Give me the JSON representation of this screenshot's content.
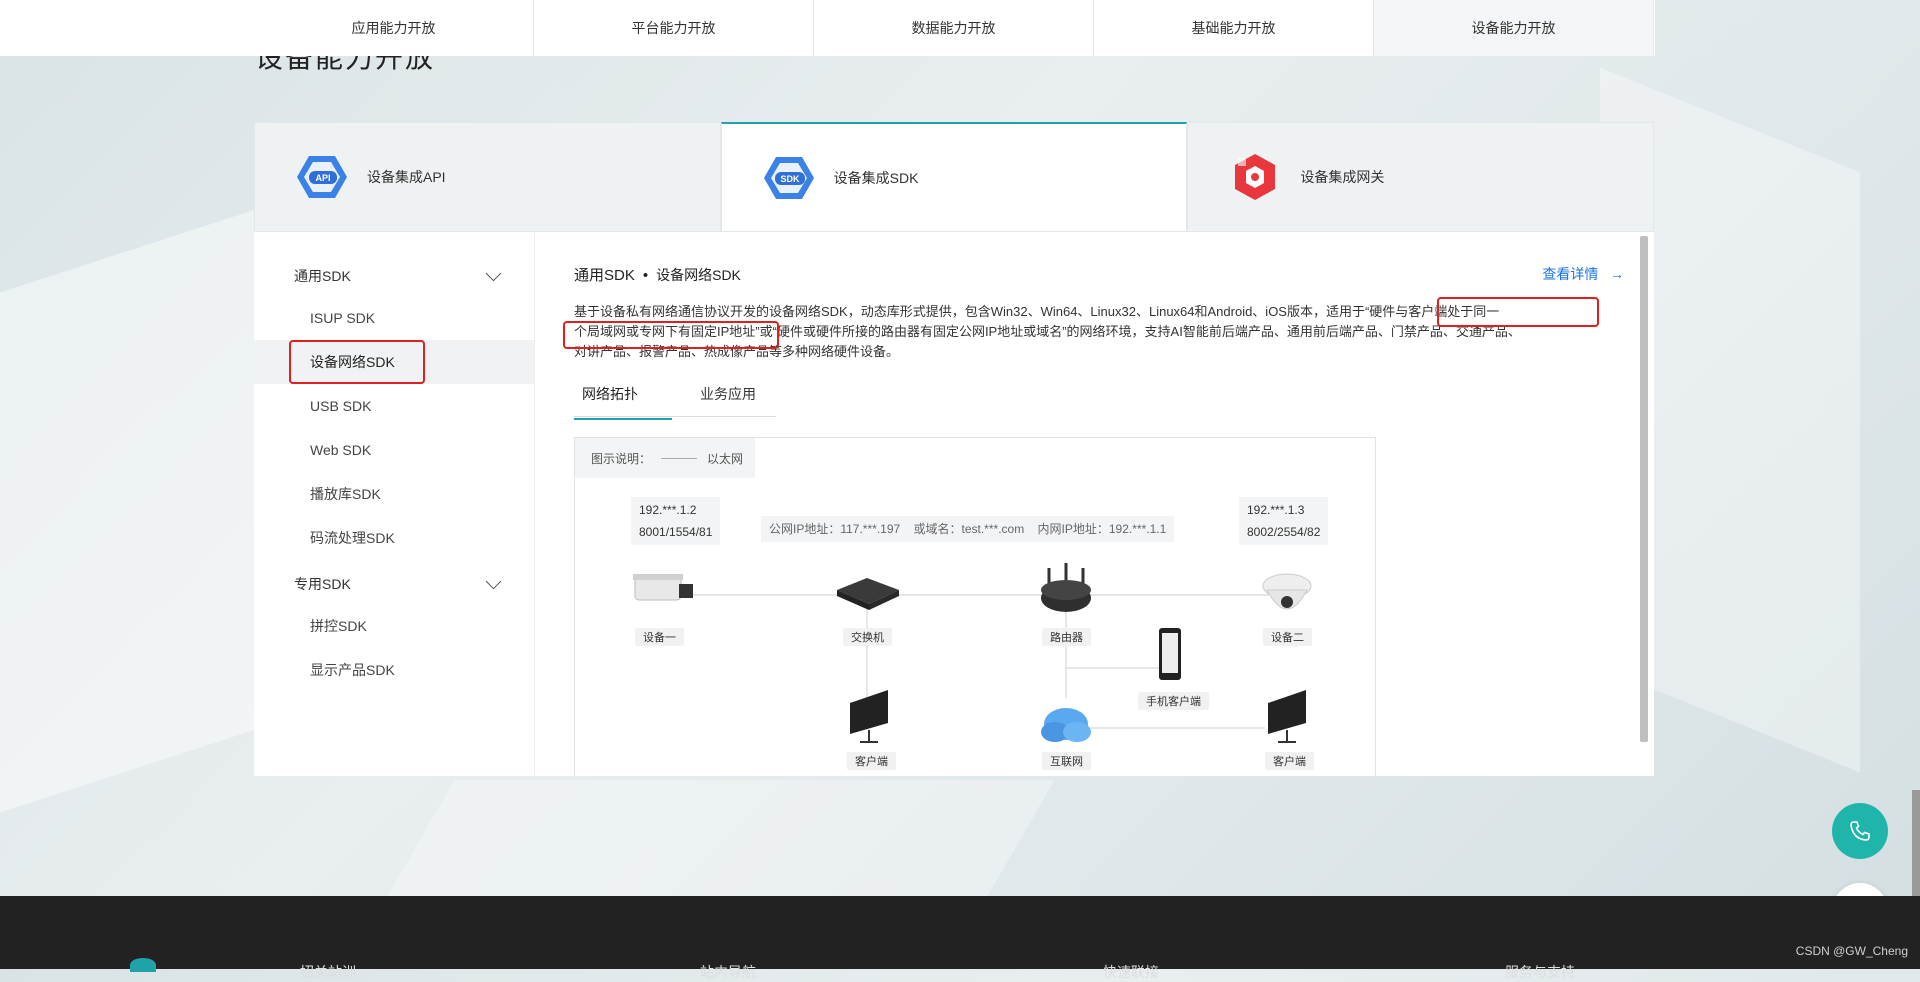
{
  "top_nav": {
    "items": [
      {
        "label": "应用能力开放",
        "active": false
      },
      {
        "label": "平台能力开放",
        "active": false
      },
      {
        "label": "数据能力开放",
        "active": false
      },
      {
        "label": "基础能力开放",
        "active": false
      },
      {
        "label": "设备能力开放",
        "active": true
      }
    ]
  },
  "section_title": "设备能力开放",
  "product_tabs": [
    {
      "label": "设备集成API",
      "icon": "api-icon",
      "active": false
    },
    {
      "label": "设备集成SDK",
      "icon": "sdk-icon",
      "active": true
    },
    {
      "label": "设备集成网关",
      "icon": "gateway-icon",
      "active": false
    }
  ],
  "sidebar": {
    "groups": [
      {
        "label": "通用SDK",
        "items": [
          "ISUP SDK",
          "设备网络SDK",
          "USB SDK",
          "Web SDK",
          "播放库SDK",
          "码流处理SDK"
        ]
      },
      {
        "label": "专用SDK",
        "items": [
          "拼控SDK",
          "显示产品SDK"
        ]
      }
    ],
    "active_item": "设备网络SDK"
  },
  "content": {
    "breadcrumb": {
      "parent": "通用SDK",
      "separator": "•",
      "current": "设备网络SDK"
    },
    "more_link": "查看详情",
    "description_lines": [
      "基于设备私有网络通信协议开发的设备网络SDK，动态库形式提供，包含Win32、Win64、Linux32、Linux64和Android、iOS版本，适用于“硬件与客户端处于同一",
      "个局域网或专网下有固定IP地址”或“硬件或硬件所接的路由器有固定公网IP地址或域名”的网络环境，支持AI智能前后端产品、通用前后端产品、门禁产品、交通产品、",
      "对讲产品、报警产品、热成像产品等多种网络硬件设备。"
    ],
    "sub_tabs": [
      {
        "label": "网络拓扑",
        "active": true
      },
      {
        "label": "业务应用",
        "active": false
      }
    ]
  },
  "diagram": {
    "legend_label": "图示说明：",
    "legend_item": "以太网",
    "device1_info": [
      "192.***.1.2",
      "8001/1554/81"
    ],
    "device2_info": [
      "192.***.1.3",
      "8002/2554/82"
    ],
    "router_info": "公网IP地址：117.***.197    或域名：test.***.com    内网IP地址：192.***.1.1",
    "nodes": {
      "device1": "设备一",
      "switch": "交换机",
      "router": "路由器",
      "device2": "设备二",
      "mobile": "手机客户端",
      "client1": "客户端",
      "internet": "互联网",
      "client2": "客户端"
    }
  },
  "footer_columns": [
    "招关站训",
    "站内导航",
    "快速联接",
    "服务与支持"
  ],
  "watermark": "CSDN @GW_Cheng",
  "colors": {
    "accent": "#1fa3a8",
    "link": "#1a73e8",
    "highlight": "#e02020",
    "footer": "#222222"
  }
}
